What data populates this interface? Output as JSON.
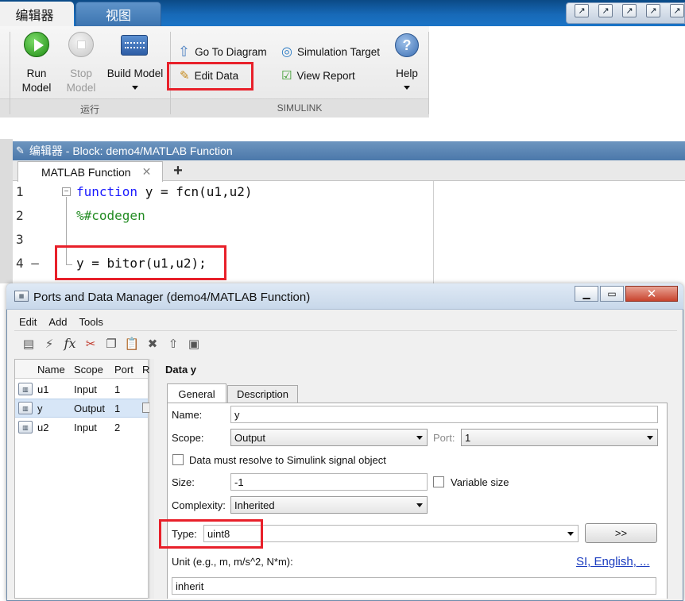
{
  "ribbon": {
    "tabs": [
      "编辑器",
      "视图"
    ],
    "run_label": [
      "Run",
      "Model"
    ],
    "stop_label": [
      "Stop",
      "Model"
    ],
    "build_label": "Build Model",
    "go_to_diagram": "Go To Diagram",
    "edit_data": "Edit Data",
    "simulation_target": "Simulation Target",
    "view_report": "View Report",
    "help_label": "Help",
    "group_run": "运行",
    "group_simulink": "SIMULINK"
  },
  "editor": {
    "title": "编辑器 - Block: demo4/MATLAB Function",
    "tab_label": "MATLAB Function",
    "lines": [
      {
        "num": "1",
        "text_kw": "function",
        "text_rest": " y = fcn(u1,u2)"
      },
      {
        "num": "2",
        "comment": "%#codegen"
      },
      {
        "num": "3"
      },
      {
        "num": "4 —",
        "text": "y = bitor(u1,u2);"
      }
    ]
  },
  "dialog": {
    "title": "Ports and Data Manager (demo4/MATLAB Function)",
    "menu": [
      "Edit",
      "Add",
      "Tools"
    ],
    "table": {
      "headers": [
        "Name",
        "Scope",
        "Port",
        "R"
      ],
      "rows": [
        {
          "name": "u1",
          "scope": "Input",
          "port": "1"
        },
        {
          "name": "y",
          "scope": "Output",
          "port": "1"
        },
        {
          "name": "u2",
          "scope": "Input",
          "port": "2"
        }
      ]
    },
    "panel_title": "Data y",
    "tabs": [
      "General",
      "Description"
    ],
    "name_label": "Name:",
    "name_value": "y",
    "scope_label": "Scope:",
    "scope_value": "Output",
    "port_label": "Port:",
    "port_value": "1",
    "resolve_label": "Data must resolve to Simulink signal object",
    "size_label": "Size:",
    "size_value": "-1",
    "variable_size_label": "Variable size",
    "complexity_label": "Complexity:",
    "complexity_value": "Inherited",
    "type_label": "Type:",
    "type_value": "uint8",
    "type_button": ">>",
    "unit_label": "Unit (e.g., m, m/s^2, N*m):",
    "unit_link": "SI, English, ...",
    "unit_value": "inherit"
  },
  "colors": {
    "highlight": "#e8202a",
    "keyword": "#1a1aff",
    "comment": "#228b22",
    "link": "#1a3bbf"
  }
}
